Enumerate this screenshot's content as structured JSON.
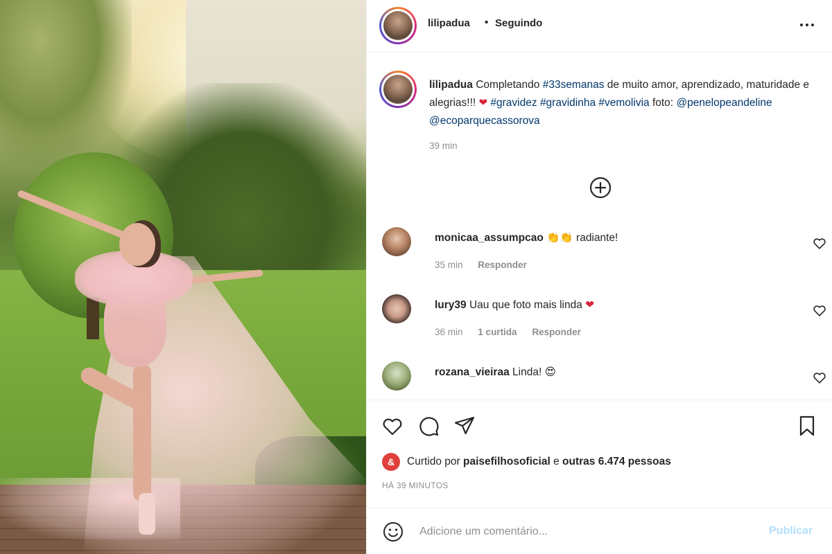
{
  "header": {
    "username": "lilipadua",
    "separator": "•",
    "follow_status": "Seguindo",
    "more_icon": "more-horizontal-icon"
  },
  "caption": {
    "username": "lilipadua",
    "text_before": "Completando",
    "hashtag_1": "#33semanas",
    "text_middle": "de muito amor, aprendizado, maturidade e alegrias!!!",
    "emoji": "❤",
    "hashtag_2": "#gravidez",
    "hashtag_3": "#gravidinha",
    "hashtag_4": "#vemolivia",
    "text_foto": "foto:",
    "mention_1": "@penelopeandeline",
    "mention_2": "@ecoparquecassorova",
    "time": "39 min"
  },
  "load_more_icon": "plus-circle-icon",
  "comments": [
    {
      "username": "monicaa_assumpcao",
      "emoji": "👏👏",
      "text": "radiante!",
      "time": "35 min",
      "likes": "",
      "reply": "Responder"
    },
    {
      "username": "lury39",
      "emoji": "",
      "text": "Uau que foto mais linda",
      "emoji_after": "❤",
      "time": "36 min",
      "likes": "1 curtida",
      "reply": "Responder"
    },
    {
      "username": "rozana_vieiraa",
      "emoji": "",
      "text": "Linda!",
      "emoji_after": "😍",
      "time": "",
      "likes": "",
      "reply": ""
    }
  ],
  "actions": {
    "like_icon": "heart-icon",
    "comment_icon": "comment-icon",
    "share_icon": "paper-plane-icon",
    "save_icon": "bookmark-icon"
  },
  "likes": {
    "badge": "&",
    "prefix": "Curtido por",
    "user": "paisefilhosoficial",
    "conjunction": "e",
    "others": "outras 6.474 pessoas"
  },
  "post_time": "HÁ 39 MINUTOS",
  "comment_box": {
    "placeholder": "Adicione um comentário...",
    "publish_label": "Publicar",
    "emoji_icon": "smiley-icon"
  },
  "colors": {
    "link": "#00376b",
    "muted": "#8e8e8e",
    "publish_disabled": "#b2dffc",
    "badge": "#e0403b"
  }
}
